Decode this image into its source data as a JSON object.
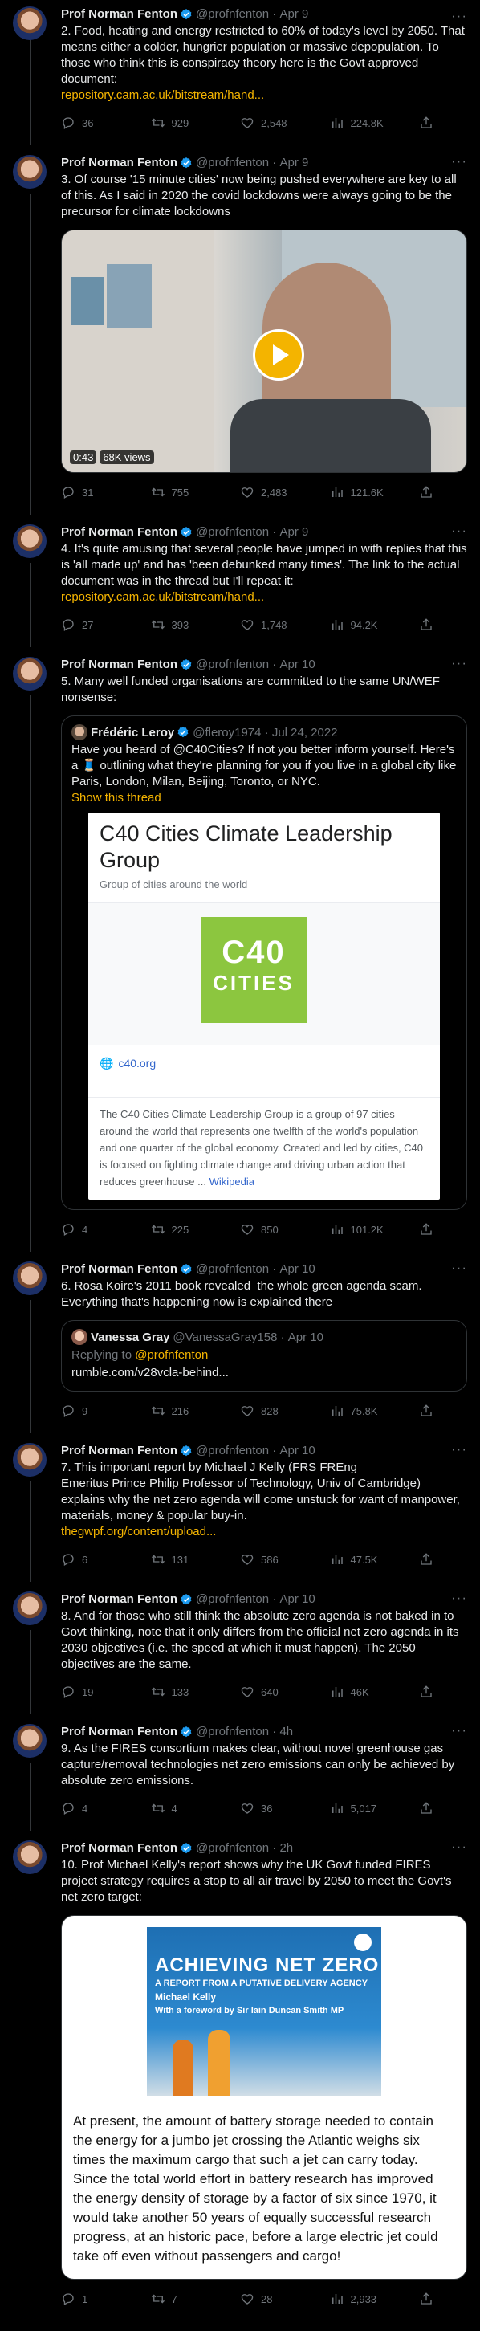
{
  "author": {
    "name": "Prof Norman Fenton",
    "handle": "@profnfenton"
  },
  "colors": {
    "accent": "#f4b400",
    "verified": "#1d9bf0",
    "muted": "#71767b"
  },
  "tweets": [
    {
      "date": "Apr 9",
      "text": "2. Food, heating and energy restricted to 60% of today's level by 2050. That means either a colder, hungrier population or massive depopulation. To those who think this is conspiracy theory here is the Govt approved document:",
      "link": "repository.cam.ac.uk/bitstream/hand...",
      "stats": {
        "replies": "36",
        "retweets": "929",
        "likes": "2,548",
        "views": "224.8K"
      }
    },
    {
      "date": "Apr 9",
      "text": "3. Of course '15 minute cities' now being pushed everywhere are key to all of this. As I said in 2020 the covid lockdowns were always going to be the precursor for climate lockdowns",
      "video": {
        "duration": "0:43",
        "views": "68K views"
      },
      "stats": {
        "replies": "31",
        "retweets": "755",
        "likes": "2,483",
        "views": "121.6K"
      }
    },
    {
      "date": "Apr 9",
      "text": "4. It's quite amusing that several people have jumped in with replies that this is 'all made up' and has 'been debunked many times'. The link to the actual document was in the thread but I'll repeat it: ",
      "link": "repository.cam.ac.uk/bitstream/hand...",
      "stats": {
        "replies": "27",
        "retweets": "393",
        "likes": "1,748",
        "views": "94.2K"
      }
    },
    {
      "date": "Apr 10",
      "text": "5. Many well funded organisations are committed to the same UN/WEF nonsense:",
      "quote": {
        "name": "Frédéric Leroy",
        "handle": "@fleroy1974",
        "date": "Jul 24, 2022",
        "text": "Have you heard of @C40Cities? If not you better inform yourself. Here's a 🧵 outlining what they're planning for you if you live in a global city like Paris, London, Milan, Beijing, Toronto, or NYC.",
        "show_thread": "Show this thread",
        "card": {
          "title": "C40 Cities Climate Leadership Group",
          "subtitle": "Group of cities around the world",
          "logo_line1": "C40",
          "logo_line2": "CITIES",
          "site": "c40.org",
          "description": "The C40 Cities Climate Leadership Group is a group of 97 cities around the world that represents one twelfth of the world's population and one quarter of the global economy. Created and led by cities, C40 is focused on fighting climate change and driving urban action that reduces greenhouse ...",
          "wiki": "Wikipedia"
        }
      },
      "stats": {
        "replies": "4",
        "retweets": "225",
        "likes": "850",
        "views": "101.2K"
      }
    },
    {
      "date": "Apr 10",
      "text": "6. Rosa Koire's 2011 book revealed  the whole green agenda scam. Everything that's happening now is explained there",
      "quote": {
        "name": "Vanessa Gray",
        "handle": "@VanessaGray158",
        "date": "Apr 10",
        "replying_prefix": "Replying to ",
        "replying_to": "@profnfenton",
        "text": "rumble.com/v28vcla-behind..."
      },
      "stats": {
        "replies": "9",
        "retweets": "216",
        "likes": "828",
        "views": "75.8K"
      }
    },
    {
      "date": "Apr 10",
      "text": "7. This important report by Michael J Kelly (FRS FREng\nEmeritus Prince Philip Professor of Technology, Univ of Cambridge) explains why the net zero agenda will come unstuck for want of manpower, materials, money & popular buy-in.",
      "link": "thegwpf.org/content/upload...",
      "stats": {
        "replies": "6",
        "retweets": "131",
        "likes": "586",
        "views": "47.5K"
      }
    },
    {
      "date": "Apr 10",
      "text": "8. And for those who still think the absolute zero agenda is not baked in to Govt thinking, note that it only differs from the official net zero agenda in its 2030 objectives (i.e. the speed at which it must happen). The 2050 objectives are the same.",
      "stats": {
        "replies": "19",
        "retweets": "133",
        "likes": "640",
        "views": "46K"
      }
    },
    {
      "date": "4h",
      "text": "9. As the FIRES consortium makes clear, without novel greenhouse gas capture/removal technologies net zero emissions can only be achieved by absolute zero emissions.",
      "stats": {
        "replies": "4",
        "retweets": "4",
        "likes": "36",
        "views": "5,017"
      }
    },
    {
      "date": "2h",
      "text": "10. Prof Michael Kelly's report shows why the UK Govt funded FIRES project strategy requires a stop to all air travel by 2050 to meet the Govt's net zero target:",
      "book": {
        "title": "ACHIEVING NET ZERO",
        "subtitle": "A REPORT FROM A PUTATIVE DELIVERY AGENCY",
        "author": "Michael Kelly",
        "foreword": "With a foreword by Sir Iain Duncan Smith MP",
        "excerpt": "At present, the amount of battery storage needed to contain the energy for a jumbo jet crossing the Atlantic weighs six times the maximum cargo that such a jet can carry today. Since the total world effort in battery research has improved the energy density of storage by a factor of six since 1970, it would take another 50 years of equally successful research progress, at an historic pace, before a large electric jet could take off even without passengers and cargo!"
      },
      "stats": {
        "replies": "1",
        "retweets": "7",
        "likes": "28",
        "views": "2,933"
      }
    }
  ]
}
